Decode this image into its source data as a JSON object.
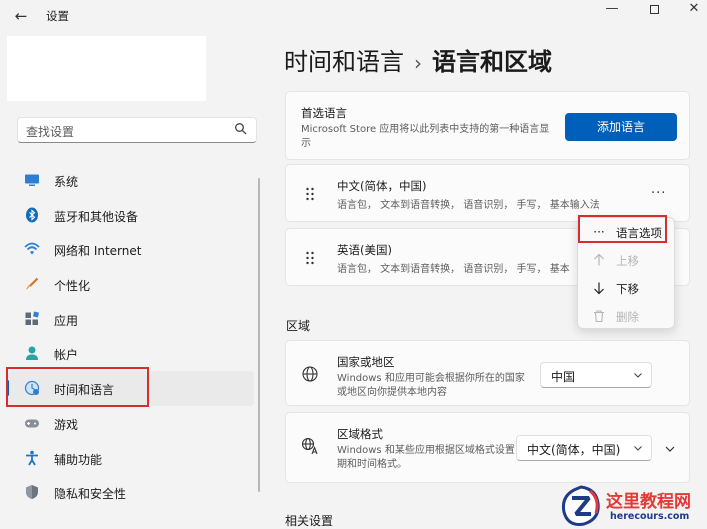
{
  "app": {
    "title": "设置"
  },
  "sidebar": {
    "search_placeholder": "查找设置",
    "items": [
      {
        "label": "系统",
        "icon": "monitor-icon"
      },
      {
        "label": "蓝牙和其他设备",
        "icon": "bluetooth-icon"
      },
      {
        "label": "网络和 Internet",
        "icon": "wifi-icon"
      },
      {
        "label": "个性化",
        "icon": "brush-icon"
      },
      {
        "label": "应用",
        "icon": "apps-icon"
      },
      {
        "label": "帐户",
        "icon": "account-icon"
      },
      {
        "label": "时间和语言",
        "icon": "time-language-icon",
        "selected": true
      },
      {
        "label": "游戏",
        "icon": "gamepad-icon"
      },
      {
        "label": "辅助功能",
        "icon": "accessibility-icon"
      },
      {
        "label": "隐私和安全性",
        "icon": "shield-icon"
      }
    ]
  },
  "header": {
    "parent": "时间和语言",
    "separator": "›",
    "current": "语言和区域"
  },
  "preferred": {
    "title": "首选语言",
    "description": "Microsoft Store 应用将以此列表中支持的第一种语言显示",
    "add_button": "添加语言"
  },
  "languages": [
    {
      "name": "中文(简体，中国)",
      "features": "语言包， 文本到语音转换， 语音识别， 手写， 基本输入法"
    },
    {
      "name": "英语(美国)",
      "features": "语言包， 文本到语音转换， 语音识别， 手写， 基本"
    }
  ],
  "context_menu": {
    "items": [
      {
        "label": "语言选项",
        "icon": "more-icon",
        "enabled": true
      },
      {
        "label": "上移",
        "icon": "arrow-up-icon",
        "enabled": false
      },
      {
        "label": "下移",
        "icon": "arrow-down-icon",
        "enabled": true
      },
      {
        "label": "删除",
        "icon": "trash-icon",
        "enabled": false
      }
    ]
  },
  "region": {
    "section_title": "区域",
    "country": {
      "title": "国家或地区",
      "description": "Windows 和应用可能会根据你所在的国家或地区向你提供本地内容",
      "value": "中国"
    },
    "format": {
      "title": "区域格式",
      "description": "Windows 和某些应用根据区域格式设置日期和时间格式。",
      "value": "中文(简体，中国)"
    }
  },
  "related": {
    "section_title": "相关设置"
  },
  "watermark": {
    "line1": "这里教程网",
    "line2": "herecours.com"
  },
  "colors": {
    "accent": "#005fb8",
    "highlight": "#d32f2f"
  }
}
